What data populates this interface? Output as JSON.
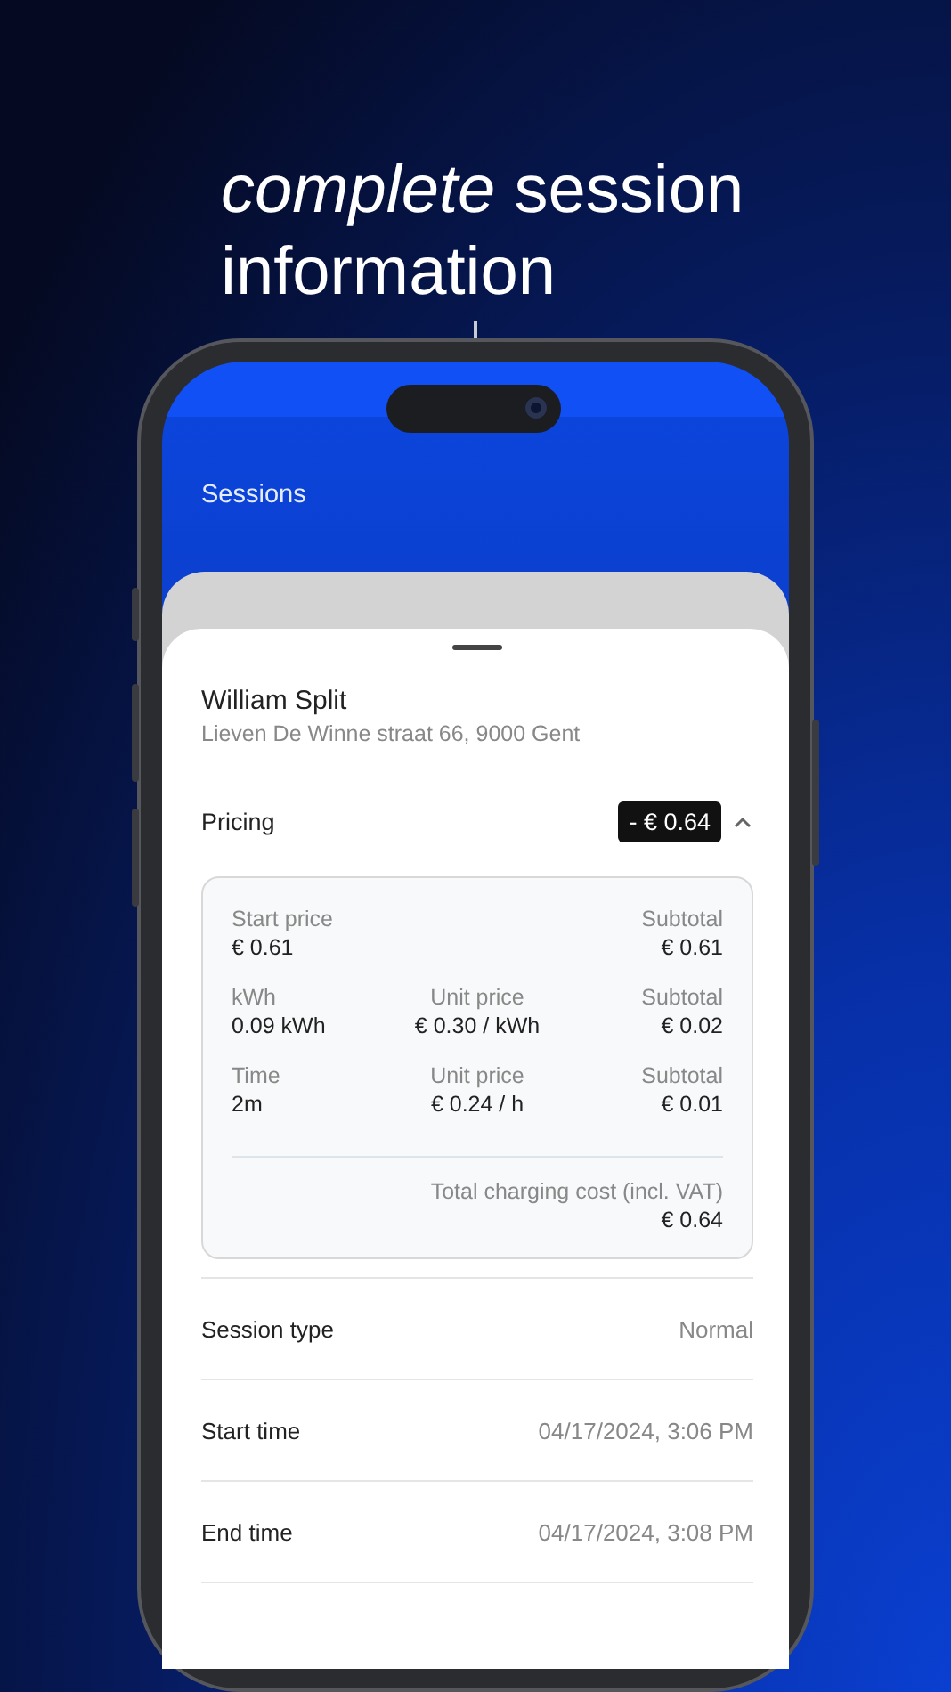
{
  "headline": [
    "*complete* session",
    "information"
  ],
  "app_bar": {
    "title": "Sessions"
  },
  "sheet": {
    "name": "William Split",
    "address": "Lieven De Winne straat 66, 9000 Gent"
  },
  "pricing": {
    "label": "Pricing",
    "amount": "- € 0.64",
    "expanded": true,
    "rows": [
      {
        "item": {
          "label": "Start price",
          "value": "€ 0.61"
        },
        "subtotal": {
          "label": "Subtotal",
          "value": "€ 0.61"
        }
      },
      {
        "item": {
          "label": "kWh",
          "value": "0.09 kWh"
        },
        "unit_price": {
          "label": "Unit price",
          "value": "€ 0.30 / kWh"
        },
        "subtotal": {
          "label": "Subtotal",
          "value": "€ 0.02"
        }
      },
      {
        "item": {
          "label": "Time",
          "value": "2m"
        },
        "unit_price": {
          "label": "Unit price",
          "value": "€ 0.24 / h"
        },
        "subtotal": {
          "label": "Subtotal",
          "value": "€ 0.01"
        }
      }
    ],
    "total": {
      "label": "Total charging cost (incl. VAT)",
      "value": "€ 0.64"
    }
  },
  "details": [
    {
      "label": "Session type",
      "value": "Normal"
    },
    {
      "label": "Start time",
      "value": "04/17/2024, 3:06 PM"
    },
    {
      "label": "End time",
      "value": "04/17/2024, 3:08 PM"
    }
  ]
}
